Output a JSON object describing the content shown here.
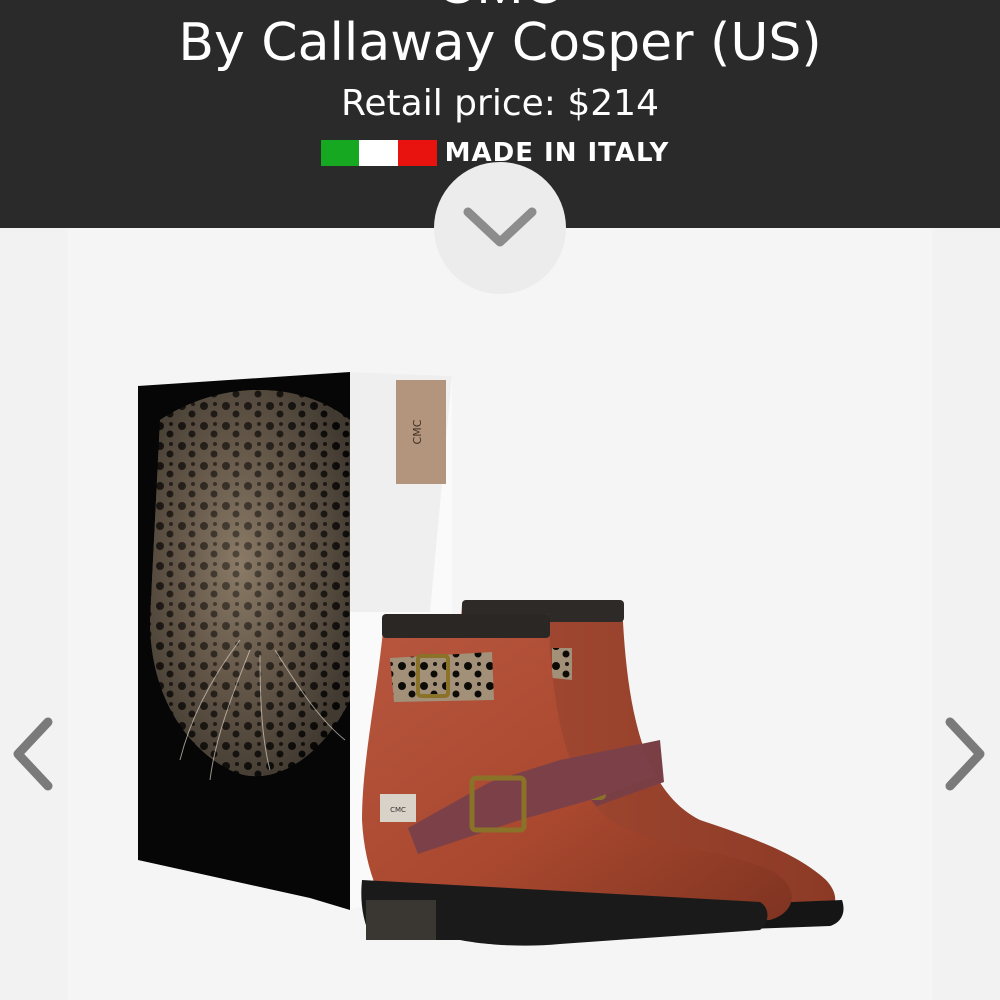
{
  "header": {
    "product_name": "CMC",
    "designer_line": "By Callaway Cosper (US)",
    "price_line": "Retail price: $214",
    "origin_label": "MADE IN ITALY",
    "flag_colors": [
      "#16a820",
      "#ffffff",
      "#e8120f"
    ],
    "background": "#2a2a2a"
  },
  "box": {
    "label": "CMC"
  },
  "boot": {
    "patch_label": "CMC"
  },
  "icons": {
    "expand": "chevron-down-icon",
    "previous": "chevron-left-icon",
    "next": "chevron-right-icon"
  }
}
